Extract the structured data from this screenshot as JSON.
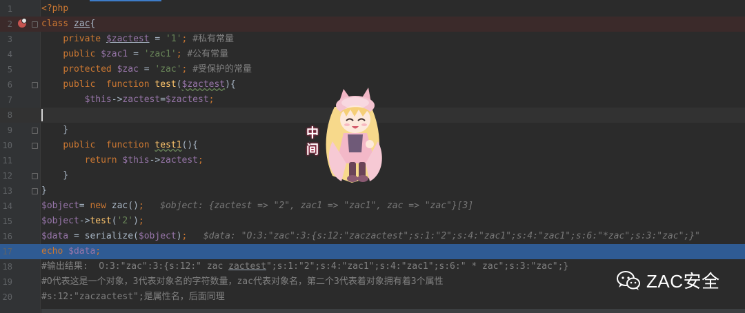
{
  "editor": {
    "language": "php",
    "lines": [
      {
        "num": "1",
        "tokens": [
          {
            "t": "tag",
            "v": "<?php"
          }
        ]
      },
      {
        "num": "2",
        "tokens": [
          {
            "t": "k",
            "v": "class "
          },
          {
            "t": "plain-ul",
            "v": "zac"
          },
          {
            "t": "plain",
            "v": "{"
          }
        ]
      },
      {
        "num": "3",
        "tokens": [
          {
            "t": "plain",
            "v": "    "
          },
          {
            "t": "k",
            "v": "private "
          },
          {
            "t": "v-ul",
            "v": "$zactest"
          },
          {
            "t": "plain",
            "v": " = "
          },
          {
            "t": "s",
            "v": "'1'"
          },
          {
            "t": "k",
            "v": "; "
          },
          {
            "t": "c",
            "v": "#私有常量"
          }
        ]
      },
      {
        "num": "4",
        "tokens": [
          {
            "t": "plain",
            "v": "    "
          },
          {
            "t": "k",
            "v": "public "
          },
          {
            "t": "v",
            "v": "$zac1"
          },
          {
            "t": "plain",
            "v": " = "
          },
          {
            "t": "s",
            "v": "'zac1'"
          },
          {
            "t": "k",
            "v": "; "
          },
          {
            "t": "c",
            "v": "#公有常量"
          }
        ]
      },
      {
        "num": "5",
        "tokens": [
          {
            "t": "plain",
            "v": "    "
          },
          {
            "t": "k",
            "v": "protected "
          },
          {
            "t": "v",
            "v": "$zac"
          },
          {
            "t": "plain",
            "v": " = "
          },
          {
            "t": "s",
            "v": "'zac'"
          },
          {
            "t": "k",
            "v": "; "
          },
          {
            "t": "c",
            "v": "#受保护的常量"
          }
        ]
      },
      {
        "num": "6",
        "tokens": [
          {
            "t": "plain",
            "v": "    "
          },
          {
            "t": "k",
            "v": "public  function "
          },
          {
            "t": "f",
            "v": "test"
          },
          {
            "t": "plain",
            "v": "("
          },
          {
            "t": "v-sq",
            "v": "$zactest"
          },
          {
            "t": "plain",
            "v": "){"
          }
        ]
      },
      {
        "num": "7",
        "tokens": [
          {
            "t": "plain",
            "v": "        "
          },
          {
            "t": "v",
            "v": "$this"
          },
          {
            "t": "plain",
            "v": "->"
          },
          {
            "t": "v",
            "v": "zactest"
          },
          {
            "t": "plain",
            "v": "="
          },
          {
            "t": "v",
            "v": "$zactest"
          },
          {
            "t": "k",
            "v": ";"
          }
        ]
      },
      {
        "num": "8",
        "tokens": []
      },
      {
        "num": "9",
        "tokens": [
          {
            "t": "plain",
            "v": "    }"
          }
        ]
      },
      {
        "num": "10",
        "tokens": [
          {
            "t": "plain",
            "v": "    "
          },
          {
            "t": "k",
            "v": "public  function "
          },
          {
            "t": "f-sq",
            "v": "test1"
          },
          {
            "t": "plain",
            "v": "(){"
          }
        ]
      },
      {
        "num": "11",
        "tokens": [
          {
            "t": "plain",
            "v": "        "
          },
          {
            "t": "k",
            "v": "return "
          },
          {
            "t": "v",
            "v": "$this"
          },
          {
            "t": "plain",
            "v": "->"
          },
          {
            "t": "v",
            "v": "zactest"
          },
          {
            "t": "k",
            "v": ";"
          }
        ]
      },
      {
        "num": "12",
        "tokens": [
          {
            "t": "plain",
            "v": "    }"
          }
        ]
      },
      {
        "num": "13",
        "tokens": [
          {
            "t": "plain",
            "v": "}"
          }
        ]
      },
      {
        "num": "14",
        "tokens": [
          {
            "t": "v",
            "v": "$object"
          },
          {
            "t": "plain",
            "v": "= "
          },
          {
            "t": "k",
            "v": "new "
          },
          {
            "t": "plain",
            "v": "zac()"
          },
          {
            "t": "k",
            "v": ";"
          },
          {
            "t": "plain",
            "v": "   "
          },
          {
            "t": "hint",
            "v": "$object: {zactest => \"2\", zac1 => \"zac1\", zac => \"zac\"}[3]"
          }
        ]
      },
      {
        "num": "15",
        "tokens": [
          {
            "t": "v",
            "v": "$object"
          },
          {
            "t": "plain",
            "v": "->"
          },
          {
            "t": "f",
            "v": "test"
          },
          {
            "t": "plain",
            "v": "("
          },
          {
            "t": "s",
            "v": "'2'"
          },
          {
            "t": "plain",
            "v": ")"
          },
          {
            "t": "k",
            "v": ";"
          }
        ]
      },
      {
        "num": "16",
        "tokens": [
          {
            "t": "v",
            "v": "$data"
          },
          {
            "t": "plain",
            "v": " = serialize("
          },
          {
            "t": "v",
            "v": "$object"
          },
          {
            "t": "plain",
            "v": ")"
          },
          {
            "t": "k",
            "v": ";"
          },
          {
            "t": "plain",
            "v": "   "
          },
          {
            "t": "hint",
            "v": "$data: \"O:3:\"zac\":3:{s:12:\"zaczactest\";s:1:\"2\";s:4:\"zac1\";s:4:\"zac1\";s:6:\"*zac\";s:3:\"zac\";}\""
          }
        ]
      },
      {
        "num": "17",
        "tokens": [
          {
            "t": "k",
            "v": "echo "
          },
          {
            "t": "v",
            "v": "$data"
          },
          {
            "t": "k",
            "v": ";"
          }
        ]
      },
      {
        "num": "18",
        "tokens": [
          {
            "t": "c",
            "v": "#输出结果:  O:3:\"zac\":3:{s:12:\" zac "
          },
          {
            "t": "c-ul",
            "v": "zactest"
          },
          {
            "t": "c",
            "v": "\";s:1:\"2\";s:4:\"zac1\";s:4:\"zac1\";s:6:\" * zac\";s:3:\"zac\";}"
          }
        ]
      },
      {
        "num": "19",
        "tokens": [
          {
            "t": "c",
            "v": "#O代表这是一个对象，3代表对象名的字符数量，zac代表对象名，第二个3代表着对象拥有着3个属性"
          }
        ]
      },
      {
        "num": "20",
        "tokens": [
          {
            "t": "c",
            "v": "#s:12:\"zaczactest\";是属性名，后面同理"
          }
        ]
      }
    ]
  },
  "sticker": {
    "text": "中间"
  },
  "watermark": {
    "text": "ZAC安全",
    "icon": "wechat-icon"
  },
  "colors": {
    "keyword": "#cc7832",
    "variable": "#9876aa",
    "string": "#6a8759",
    "comment": "#808080",
    "function": "#ffc66d",
    "selection": "#2f5b93"
  }
}
